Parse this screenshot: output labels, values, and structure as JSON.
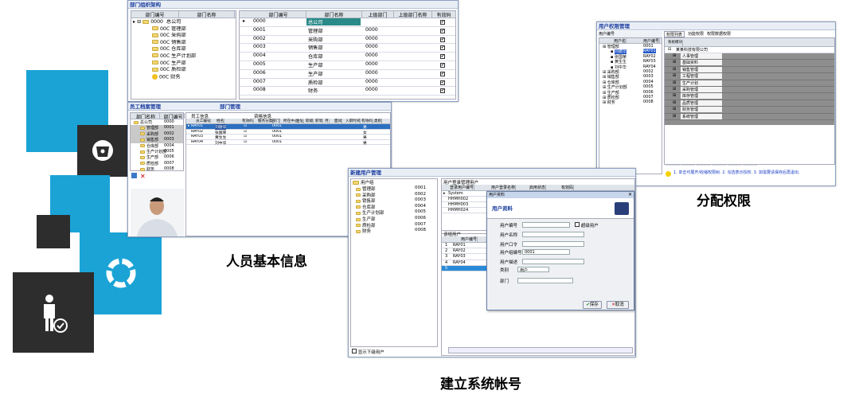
{
  "captions": {
    "personnel": "人员基本信息",
    "accounts": "建立系统帐号",
    "permissions": "分配权限"
  },
  "org_window": {
    "title": "部门组织架构",
    "tree_headers": [
      "部门编号",
      "部门名称"
    ],
    "tree_root": {
      "code": "0000",
      "name": "总公司"
    },
    "tree_items": [
      "00C 管理部",
      "00C 采购部",
      "00C 销售部",
      "00C 仓库部",
      "00C 生产计划部",
      "00C 生产部",
      "00C 质检部",
      "00C 财务"
    ],
    "grid_headers": [
      "部门编号",
      "部门名称",
      "上级部门",
      "上级部门名称",
      "有效码"
    ],
    "rows": [
      {
        "code": "0000",
        "name": "总公司",
        "parent": ""
      },
      {
        "code": "0001",
        "name": "管理部",
        "parent": "0000"
      },
      {
        "code": "0002",
        "name": "采购部",
        "parent": "0000"
      },
      {
        "code": "0003",
        "name": "销售部",
        "parent": "0000"
      },
      {
        "code": "0004",
        "name": "仓库部",
        "parent": "0000"
      },
      {
        "code": "0005",
        "name": "生产部",
        "parent": "0000"
      },
      {
        "code": "0006",
        "name": "生产部",
        "parent": "0000"
      },
      {
        "code": "0007",
        "name": "质检部",
        "parent": "0000"
      },
      {
        "code": "0008",
        "name": "财务",
        "parent": "0000"
      }
    ]
  },
  "staff_window": {
    "title": "员工档案管理",
    "subtitle": "部门管理",
    "left_headers": [
      "部门名称",
      "部门编号"
    ],
    "left_items": [
      {
        "name": "总公司",
        "code": "0000"
      },
      {
        "name": "管理部",
        "code": "0001"
      },
      {
        "name": "采购部",
        "code": "0002"
      },
      {
        "name": "销售部",
        "code": "0003"
      },
      {
        "name": "仓库部",
        "code": "0004"
      },
      {
        "name": "生产计划部",
        "code": "0005"
      },
      {
        "name": "生产部",
        "code": "0006"
      },
      {
        "name": "质检部",
        "code": "0007"
      },
      {
        "name": "财务",
        "code": "0008"
      }
    ],
    "group1": "员工信息",
    "group2": "资格信息",
    "grid_headers": [
      "员工编号",
      "姓名",
      "有效码",
      "服务分类",
      "部门",
      "所在中心",
      "住址",
      "职级",
      "职等",
      "月",
      "面试",
      "入职时间",
      "有效码",
      "类别"
    ],
    "rows": [
      {
        "id": "RAY01",
        "name": "刘德华",
        "dept": "0001",
        "gender": "男"
      },
      {
        "id": "RAY02",
        "name": "张国荣",
        "dept": "0001",
        "gender": "女"
      },
      {
        "id": "RAY03",
        "name": "黄生生",
        "dept": "0001",
        "gender": "男"
      },
      {
        "id": "RAY04",
        "name": "刘中华",
        "dept": "0001",
        "gender": "男"
      }
    ]
  },
  "account_window": {
    "title": "新建用户管理",
    "group_label": "用户组",
    "groups": [
      {
        "name": "管理部",
        "code": "0001"
      },
      {
        "name": "采购部",
        "code": "0002"
      },
      {
        "name": "销售部",
        "code": "0003"
      },
      {
        "name": "仓库部",
        "code": "0004"
      },
      {
        "name": "生产计划部",
        "code": "0005"
      },
      {
        "name": "生产部",
        "code": "0006"
      },
      {
        "name": "质检部",
        "code": "0007"
      },
      {
        "name": "财务",
        "code": "0008"
      }
    ],
    "users_label": "用户登录管理用户",
    "user_headers": [
      "登录用户编号",
      "用户登录名称",
      "启用状态",
      "有效码"
    ],
    "users": [
      "System",
      "HHMH002",
      "HHMH003",
      "HHMH024"
    ],
    "group_users_label": "该组用户",
    "group_user_headers": [
      "用户编号"
    ],
    "group_users": [
      "1",
      "2",
      "3",
      "4",
      "5"
    ],
    "group_user_codes": [
      "RAY01",
      "RAY02",
      "RAY03",
      "RAY04"
    ],
    "show_subgroups": "显示下级用户",
    "dialog": {
      "title": "用户资料",
      "header": "用户资料",
      "fields": [
        "用户编号",
        "用户名称",
        "用户口令",
        "用户组编号",
        "用户描述",
        "类别",
        "部门"
      ],
      "group_value": "0001",
      "type_value": "用户",
      "admin_label": "超级用户",
      "save": "保存",
      "cancel": "取消"
    }
  },
  "perm_window": {
    "title": "用户权限管理",
    "left_headers": [
      "用户编号"
    ],
    "left_header2": [
      "用户名",
      "用户编号"
    ],
    "left_items": [
      {
        "name": "管理部",
        "code": "0001"
      },
      {
        "name": "刘德华",
        "code": "RAY01"
      },
      {
        "name": "张国荣",
        "code": "RAY02"
      },
      {
        "name": "黄生生",
        "code": "RAY03"
      },
      {
        "name": "刘中华",
        "code": "RAY04"
      },
      {
        "name": "采购部",
        "code": "0002"
      },
      {
        "name": "销售部",
        "code": "0003"
      },
      {
        "name": "仓库部",
        "code": "0004"
      },
      {
        "name": "生产计划部",
        "code": "0005"
      },
      {
        "name": "生产部",
        "code": "0006"
      },
      {
        "name": "质检部",
        "code": "0007"
      },
      {
        "name": "财务",
        "code": "0008"
      }
    ],
    "tabs": [
      "权限列表",
      "功能权限",
      "权限数据权限"
    ],
    "modules": [
      "系统模块",
      "人事管理",
      "基础资料",
      "销售管理",
      "工程管理",
      "生产计划",
      "采购管理",
      "库存管理",
      "品质管理",
      "财务管理",
      "系统管理"
    ],
    "company": "某某科技有限公司",
    "note": "1. 单击可展开/收缩权限树. 2. 勾选表示授权. 3. 如需要请保存后再退出."
  }
}
